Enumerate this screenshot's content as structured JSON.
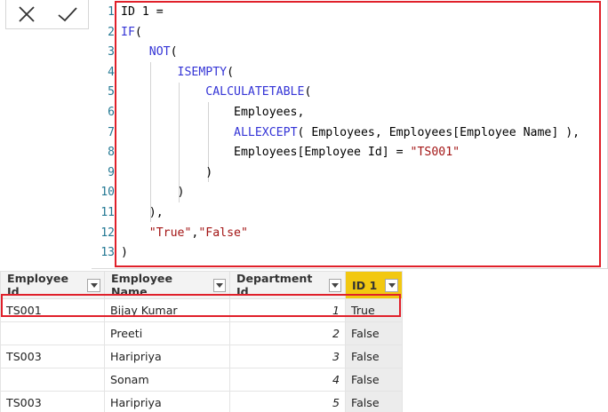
{
  "formula_bar": {
    "cancel_icon": "close-icon",
    "commit_icon": "check-icon",
    "line_numbers": [
      "1",
      "2",
      "3",
      "4",
      "5",
      "6",
      "7",
      "8",
      "9",
      "10",
      "11",
      "12",
      "13"
    ],
    "lines": [
      [
        {
          "t": "ID 1 = ",
          "c": "plain"
        }
      ],
      [
        {
          "t": "IF",
          "c": "kw"
        },
        {
          "t": "(",
          "c": "plain"
        }
      ],
      [
        {
          "t": "    ",
          "c": "plain"
        },
        {
          "t": "NOT",
          "c": "kw"
        },
        {
          "t": "(",
          "c": "plain"
        }
      ],
      [
        {
          "t": "        ",
          "c": "plain"
        },
        {
          "t": "ISEMPTY",
          "c": "kw"
        },
        {
          "t": "(",
          "c": "plain"
        }
      ],
      [
        {
          "t": "            ",
          "c": "plain"
        },
        {
          "t": "CALCULATETABLE",
          "c": "kw"
        },
        {
          "t": "(",
          "c": "plain"
        }
      ],
      [
        {
          "t": "                Employees,",
          "c": "plain"
        }
      ],
      [
        {
          "t": "                ",
          "c": "plain"
        },
        {
          "t": "ALLEXCEPT",
          "c": "kw"
        },
        {
          "t": "( Employees, Employees[Employee Name] ),",
          "c": "plain"
        }
      ],
      [
        {
          "t": "                Employees[Employee Id] = ",
          "c": "plain"
        },
        {
          "t": "\"TS001\"",
          "c": "str"
        }
      ],
      [
        {
          "t": "            )",
          "c": "plain"
        }
      ],
      [
        {
          "t": "        )",
          "c": "plain"
        }
      ],
      [
        {
          "t": "    ),",
          "c": "plain"
        }
      ],
      [
        {
          "t": "    ",
          "c": "plain"
        },
        {
          "t": "\"True\"",
          "c": "str"
        },
        {
          "t": ",",
          "c": "plain"
        },
        {
          "t": "\"False\"",
          "c": "str"
        }
      ],
      [
        {
          "t": ")",
          "c": "plain"
        }
      ]
    ]
  },
  "table": {
    "columns": [
      {
        "label": "Employee Id",
        "icon": "chevron-down-icon"
      },
      {
        "label": "Employee Name",
        "icon": "chevron-down-icon"
      },
      {
        "label": "Department Id",
        "icon": "chevron-down-icon"
      },
      {
        "label": "ID 1",
        "icon": "chevron-down-icon"
      }
    ],
    "rows": [
      [
        "TS001",
        "Bijay Kumar",
        "1",
        "True"
      ],
      [
        "",
        "Preeti",
        "2",
        "False"
      ],
      [
        "TS003",
        "Haripriya",
        "3",
        "False"
      ],
      [
        "",
        "Sonam",
        "4",
        "False"
      ],
      [
        "TS003",
        "Haripriya",
        "5",
        "False"
      ]
    ]
  },
  "colors": {
    "highlight_border": "#e0202a",
    "selected_column_header": "#f2c811",
    "keyword": "#3535d6",
    "string": "#a31515",
    "line_number": "#237893"
  }
}
